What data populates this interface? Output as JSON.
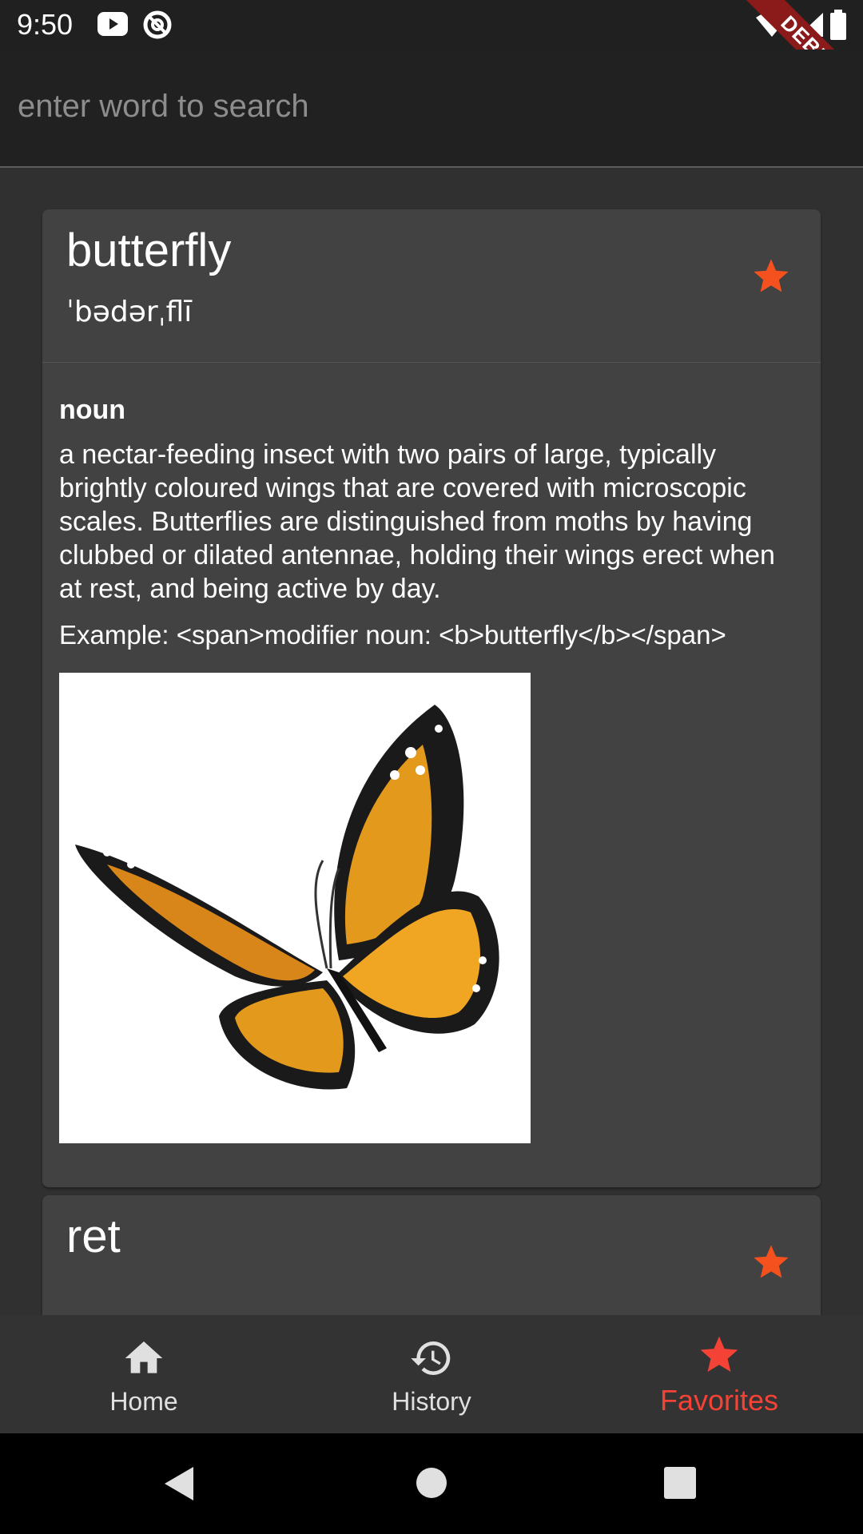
{
  "status_bar": {
    "time": "9:50"
  },
  "debug_label": "DEBUG",
  "search": {
    "placeholder": "enter word to search",
    "value": ""
  },
  "entries": [
    {
      "word": "butterfly",
      "phonetic": "ˈbədərˌflī",
      "favorite": true,
      "part_of_speech": "noun",
      "definition": "a nectar-feeding insect with two pairs of large, typically brightly coloured wings that are covered with microscopic scales. Butterflies are distinguished from moths by having clubbed or dilated antennae, holding their wings erect when at rest, and being active by day.",
      "example": "Example: <span>modifier noun: <b>butterfly</b></span>",
      "image": "butterfly-photo"
    },
    {
      "word": "ret",
      "favorite": true
    }
  ],
  "bottom_nav": {
    "items": [
      {
        "label": "Home",
        "icon": "home-icon"
      },
      {
        "label": "History",
        "icon": "history-icon"
      },
      {
        "label": "Favorites",
        "icon": "star-icon",
        "active": true
      }
    ]
  },
  "colors": {
    "accent": "#f44336",
    "star": "#f4511e",
    "card": "#424242",
    "background": "#303030",
    "appbar": "#212121"
  }
}
